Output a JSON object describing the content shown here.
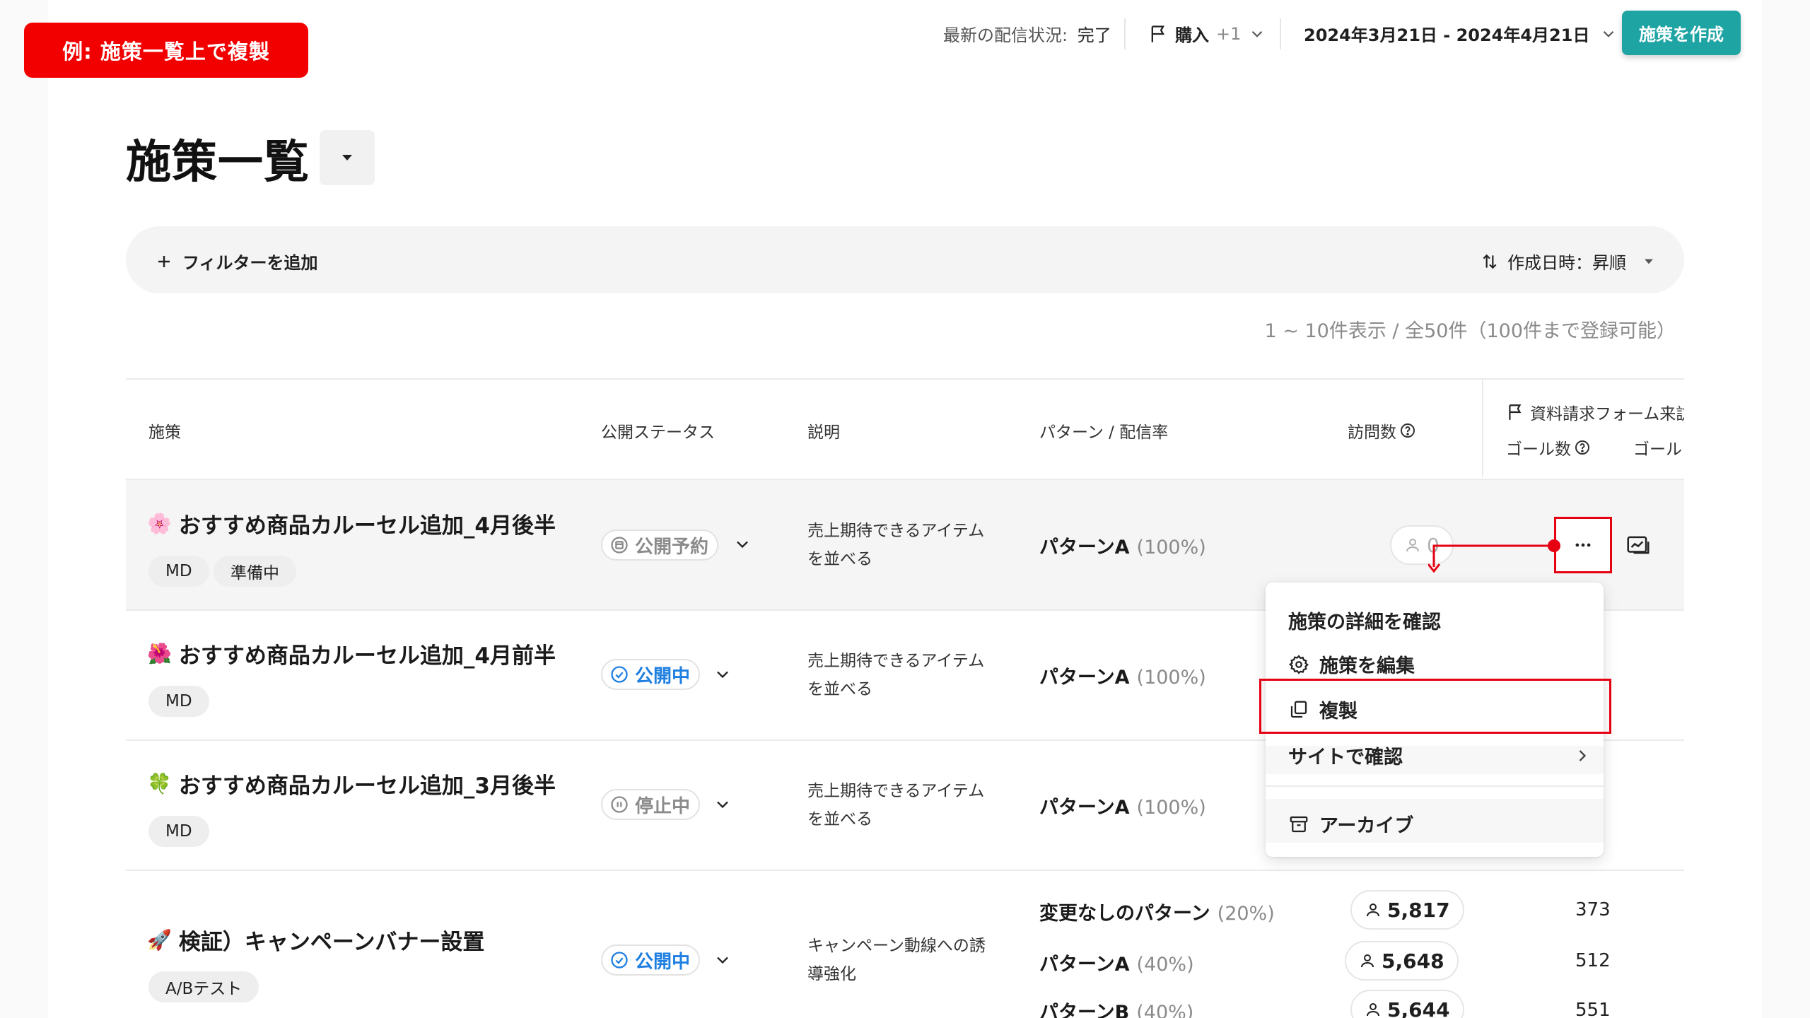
{
  "annotation": {
    "label": "例: 施策一覧上で複製"
  },
  "topbar": {
    "delivery_status_label": "最新の配信状況:",
    "delivery_status_value": "完了",
    "goal_label": "購入",
    "goal_extra": "+1",
    "date_range": "2024年3月21日 - 2024年4月21日",
    "create_button": "施策を作成"
  },
  "page": {
    "title": "施策一覧"
  },
  "filter": {
    "add_filter": "フィルターを追加",
    "sort_label": "作成日時：昇順",
    "count_text": "1 ~ 10件表示 / 全50件（100件まで登録可能）"
  },
  "table": {
    "headers": {
      "campaign": "施策",
      "status": "公開ステータス",
      "description": "説明",
      "pattern": "パターン / 配信率",
      "visits": "訪問数",
      "goal_group": "資料請求フォーム来訪",
      "goal_count": "ゴール数",
      "goal_rate": "ゴール"
    },
    "rows": [
      {
        "icon": "🌸",
        "title": "おすすめ商品カルーセル追加_4月後半",
        "tags": [
          "MD",
          "準備中"
        ],
        "status": "公開予約",
        "description": "売上期待できるアイテムを並べる",
        "patterns": [
          {
            "name": "パターンA",
            "pct": "(100%)",
            "visits": "0"
          }
        ]
      },
      {
        "icon": "🌺",
        "title": "おすすめ商品カルーセル追加_4月前半",
        "tags": [
          "MD"
        ],
        "status": "公開中",
        "description": "売上期待できるアイテムを並べる",
        "patterns": [
          {
            "name": "パターンA",
            "pct": "(100%)"
          }
        ]
      },
      {
        "icon": "🍀",
        "title": "おすすめ商品カルーセル追加_3月後半",
        "tags": [
          "MD"
        ],
        "status": "停止中",
        "description": "売上期待できるアイテムを並べる",
        "patterns": [
          {
            "name": "パターンA",
            "pct": "(100%)"
          }
        ]
      },
      {
        "icon": "🚀",
        "title": "検証）キャンペーンバナー設置",
        "tags": [
          "A/Bテスト"
        ],
        "status": "公開中",
        "description": "キャンペーン動線への誘導強化",
        "patterns": [
          {
            "name": "変更なしのパターン",
            "pct": "(20%)",
            "visits": "5,817",
            "goals": "373"
          },
          {
            "name": "パターンA",
            "pct": "(40%)",
            "visits": "5,648",
            "goals": "512"
          },
          {
            "name": "パターンB",
            "pct": "(40%)",
            "visits": "5,644",
            "goals": "551"
          }
        ]
      }
    ]
  },
  "menu": {
    "items": [
      "施策の詳細を確認",
      "施策を編集",
      "複製",
      "サイトで確認",
      "アーカイブ"
    ]
  },
  "colors": {
    "accent": "#1fa4a4",
    "annotation_red": "#e50012",
    "live_blue": "#1e7fe0"
  }
}
